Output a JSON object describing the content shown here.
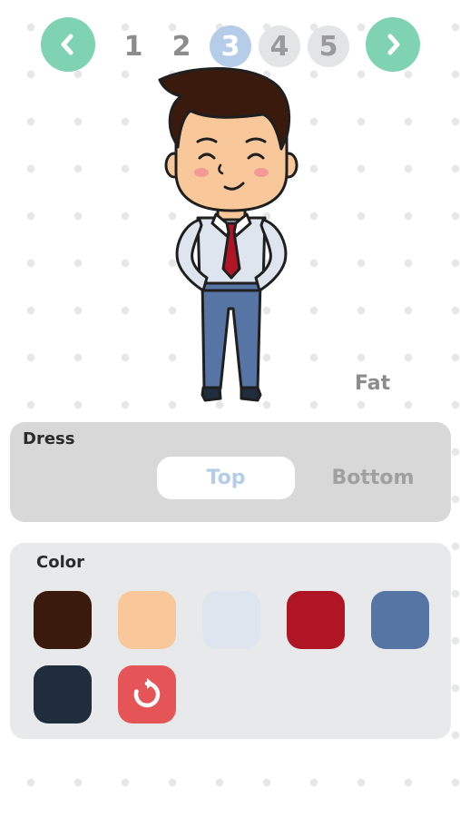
{
  "nav": {
    "prev_icon": "chevron-left-icon",
    "next_icon": "chevron-right-icon",
    "steps": [
      "1",
      "2",
      "3",
      "4",
      "5"
    ],
    "current_step": 3
  },
  "character": {
    "body_type_label": "Fat"
  },
  "dress": {
    "title": "Dress",
    "tabs": [
      {
        "label": "Top",
        "active": true
      },
      {
        "label": "Bottom",
        "active": false
      }
    ]
  },
  "color": {
    "title": "Color",
    "swatches": [
      "#3a1a0c",
      "#f8c89a",
      "#dfe5ee",
      "#b01526",
      "#5775a4",
      "#1f2d3d"
    ],
    "reset_icon": "reset-icon"
  },
  "colors": {
    "accent": "#7fd2b2",
    "step_current": "#b5cde8",
    "reset": "#e55557"
  }
}
